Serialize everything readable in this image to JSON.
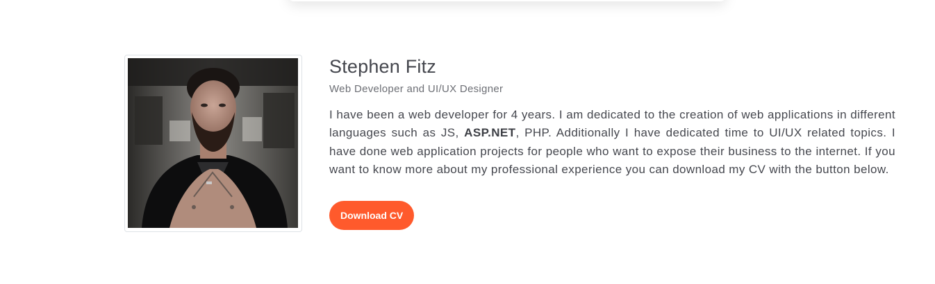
{
  "profile": {
    "name": "Stephen Fitz",
    "role": "Web Developer and UI/UX Designer",
    "bio_part1": "I have been a web developer for 4 years. I am dedicated to the creation of web applications in different languages such as JS, ",
    "bio_bold": "ASP.NET",
    "bio_part2": ", PHP. Additionally I have dedicated time to UI/UX related topics. I have done web application projects for people who want to expose their business to the internet. If you want to know more about my professional experience you can download my CV with the button below.",
    "download_label": "Download CV"
  },
  "colors": {
    "accent": "#ff5a2c",
    "text": "#45474e",
    "muted": "#6c6e74"
  }
}
